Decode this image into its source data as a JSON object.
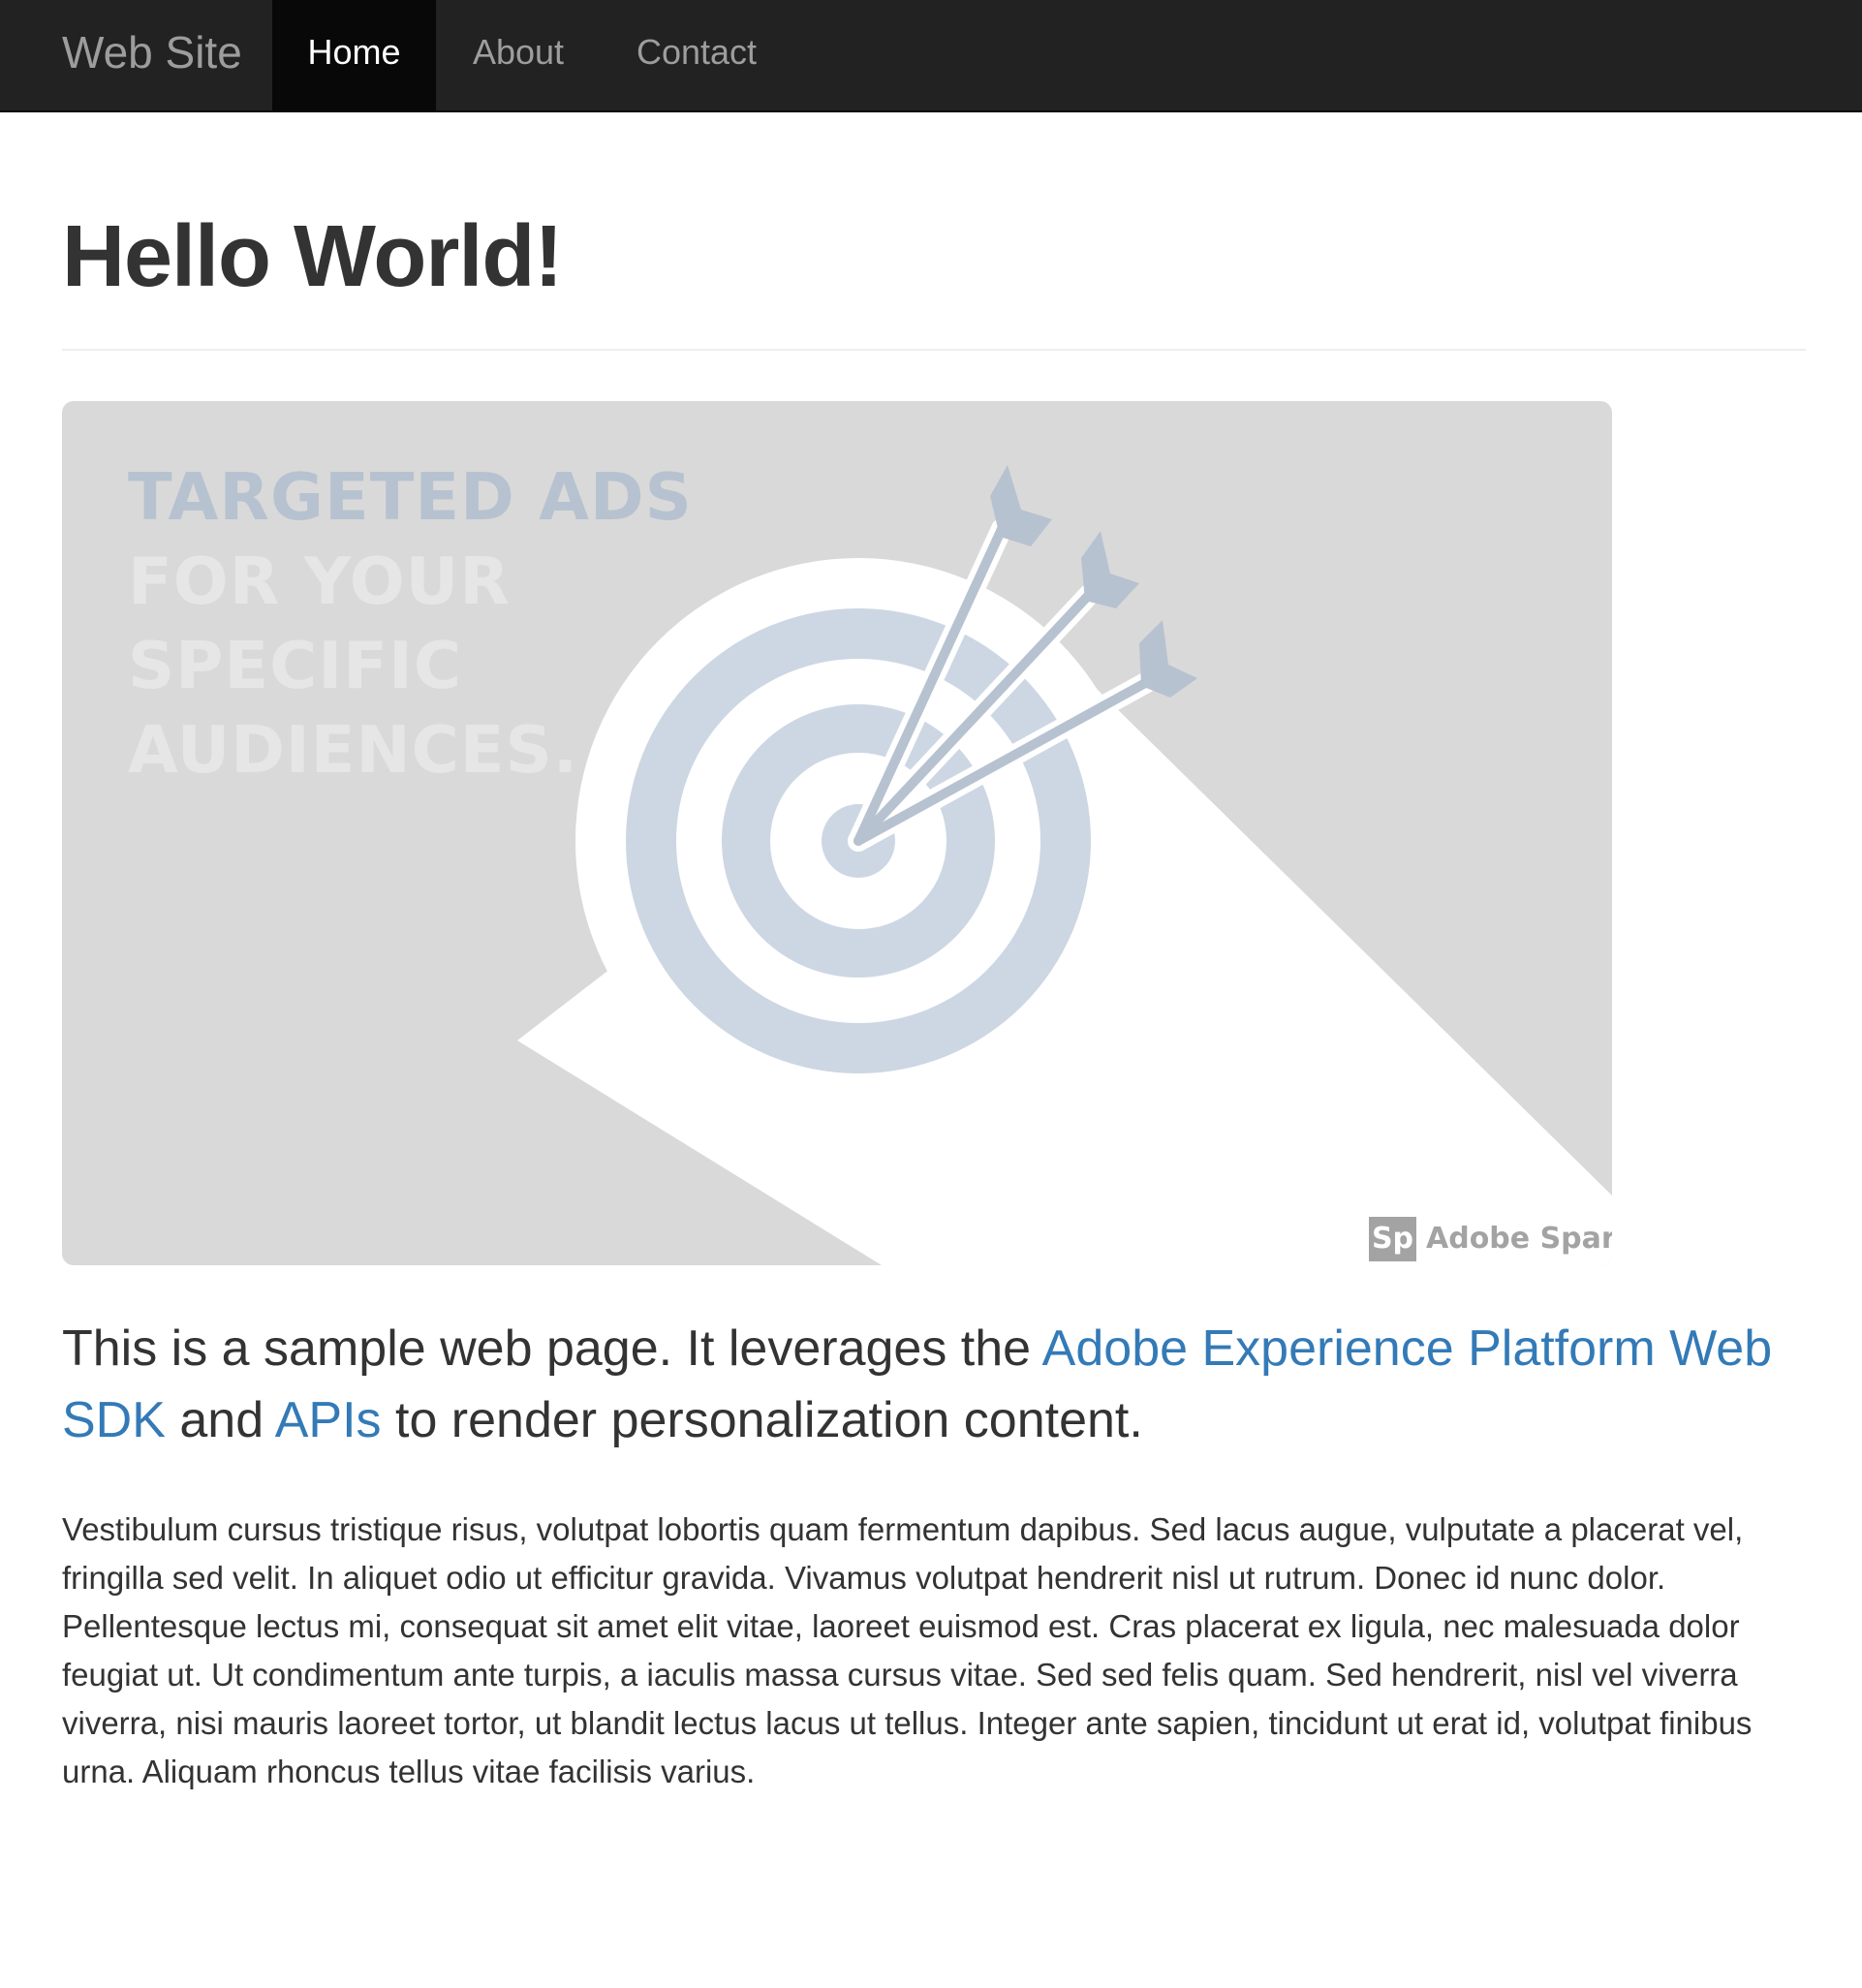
{
  "navbar": {
    "brand": "Web Site",
    "items": [
      {
        "label": "Home",
        "active": true
      },
      {
        "label": "About",
        "active": false
      },
      {
        "label": "Contact",
        "active": false
      }
    ]
  },
  "page": {
    "title": "Hello World!"
  },
  "hero": {
    "lines": [
      "TARGETED ADS",
      "FOR YOUR",
      "SPECIFIC",
      "AUDIENCES."
    ],
    "badge": "Sp",
    "badge_label": "Adobe Spark",
    "icon": "target-with-arrows-icon"
  },
  "lead": {
    "text_1": "This is a sample web page. It leverages the ",
    "link_sdk": "Adobe Experience Platform Web SDK",
    "text_2": " and ",
    "link_apis": "APIs",
    "text_3": " to render personalization content."
  },
  "body": {
    "paragraph": "Vestibulum cursus tristique risus, volutpat lobortis quam fermentum dapibus. Sed lacus augue, vulputate a placerat vel, fringilla sed velit. In aliquet odio ut efficitur gravida. Vivamus volutpat hendrerit nisl ut rutrum. Donec id nunc dolor. Pellentesque lectus mi, consequat sit amet elit vitae, laoreet euismod est. Cras placerat ex ligula, nec malesuada dolor feugiat ut. Ut condimentum ante turpis, a iaculis massa cursus vitae. Sed sed felis quam. Sed hendrerit, nisl vel viverra viverra, nisi mauris laoreet tortor, ut blandit lectus lacus ut tellus. Integer ante sapien, tincidunt ut erat id, volutpat finibus urna. Aliquam rhoncus tellus vitae facilisis varius."
  },
  "colors": {
    "navbar_bg": "#222222",
    "nav_active_bg": "#080808",
    "link": "#337ab7",
    "hero_bg": "#d9d9d9",
    "target_ring": "#cdd7e3",
    "arrow": "#b7c2d0"
  }
}
